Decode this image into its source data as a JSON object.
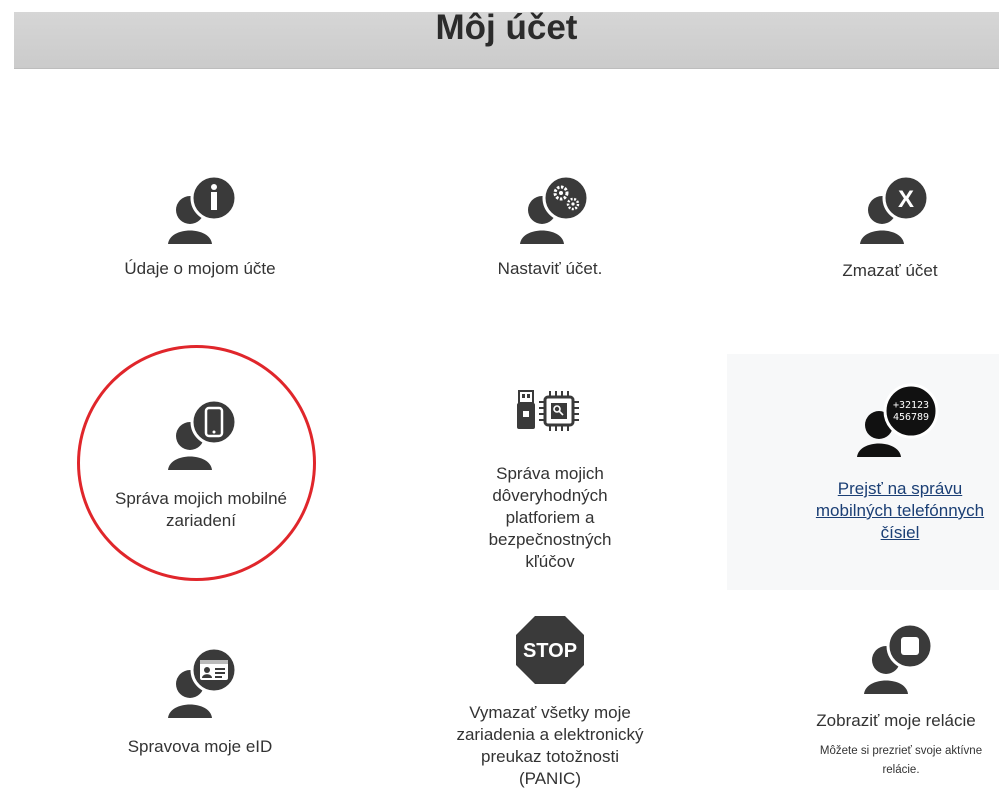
{
  "header": {
    "title": "Môj účet"
  },
  "tiles": [
    {
      "id": "account-info",
      "label": "Údaje o mojom účte",
      "icon": "user-info-icon"
    },
    {
      "id": "account-settings",
      "label": "Nastaviť účet.",
      "icon": "user-settings-icon"
    },
    {
      "id": "delete-account",
      "label": "Zmazať účet",
      "icon": "user-delete-icon"
    },
    {
      "id": "mobile-devices",
      "label": "Správa mojich mobilné zariadení",
      "icon": "user-mobile-icon"
    },
    {
      "id": "trusted-platforms",
      "label": "Správa mojich dôveryhodných platforiem a bezpečnostných kľúčov",
      "icon": "usb-chip-icon"
    },
    {
      "id": "phone-numbers",
      "label": "Prejsť na správu mobilných telefónnych čísiel",
      "icon": "user-phone-number-icon",
      "phone_text_line1": "+32123",
      "phone_text_line2": "456789"
    },
    {
      "id": "eid",
      "label": "Spravova moje eID",
      "icon": "user-id-card-icon"
    },
    {
      "id": "panic",
      "label": "Vymazať všetky moje zariadenia a elektronický preukaz totožnosti (PANIC)",
      "icon": "stop-sign-icon",
      "stop_text": "STOP"
    },
    {
      "id": "sessions",
      "label": "Zobraziť moje relácie",
      "sub": "Môžete si prezrieť svoje aktívne relácie.",
      "icon": "user-sessions-icon"
    }
  ],
  "colors": {
    "icon": "#3a3a3a",
    "highlight": "#e0262b",
    "link": "#1b3f75"
  }
}
